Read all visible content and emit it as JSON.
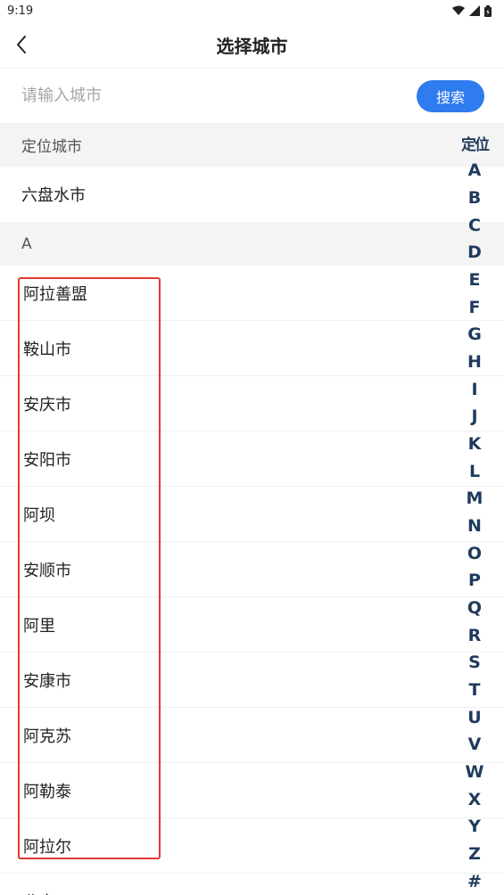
{
  "status_bar": {
    "time": "9:19"
  },
  "header": {
    "title": "选择城市"
  },
  "search": {
    "placeholder": "请输入城市",
    "value": "",
    "button_label": "搜索"
  },
  "located": {
    "section_label": "定位城市",
    "city": "六盘水市"
  },
  "section_a": {
    "letter": "A",
    "cities": [
      "阿拉善盟",
      "鞍山市",
      "安庆市",
      "安阳市",
      "阿坝",
      "安顺市",
      "阿里",
      "安康市",
      "阿克苏",
      "阿勒泰",
      "阿拉尔"
    ]
  },
  "next_row_partial": "北京",
  "index_bar": {
    "head": "定位",
    "letters": [
      "A",
      "B",
      "C",
      "D",
      "E",
      "F",
      "G",
      "H",
      "I",
      "J",
      "K",
      "L",
      "M",
      "N",
      "O",
      "P",
      "Q",
      "R",
      "S",
      "T",
      "U",
      "V",
      "W",
      "X",
      "Y",
      "Z",
      "#"
    ]
  },
  "colors": {
    "accent": "#2f7bf0",
    "index_text": "#1f3a5c",
    "highlight": "#e23a34"
  }
}
